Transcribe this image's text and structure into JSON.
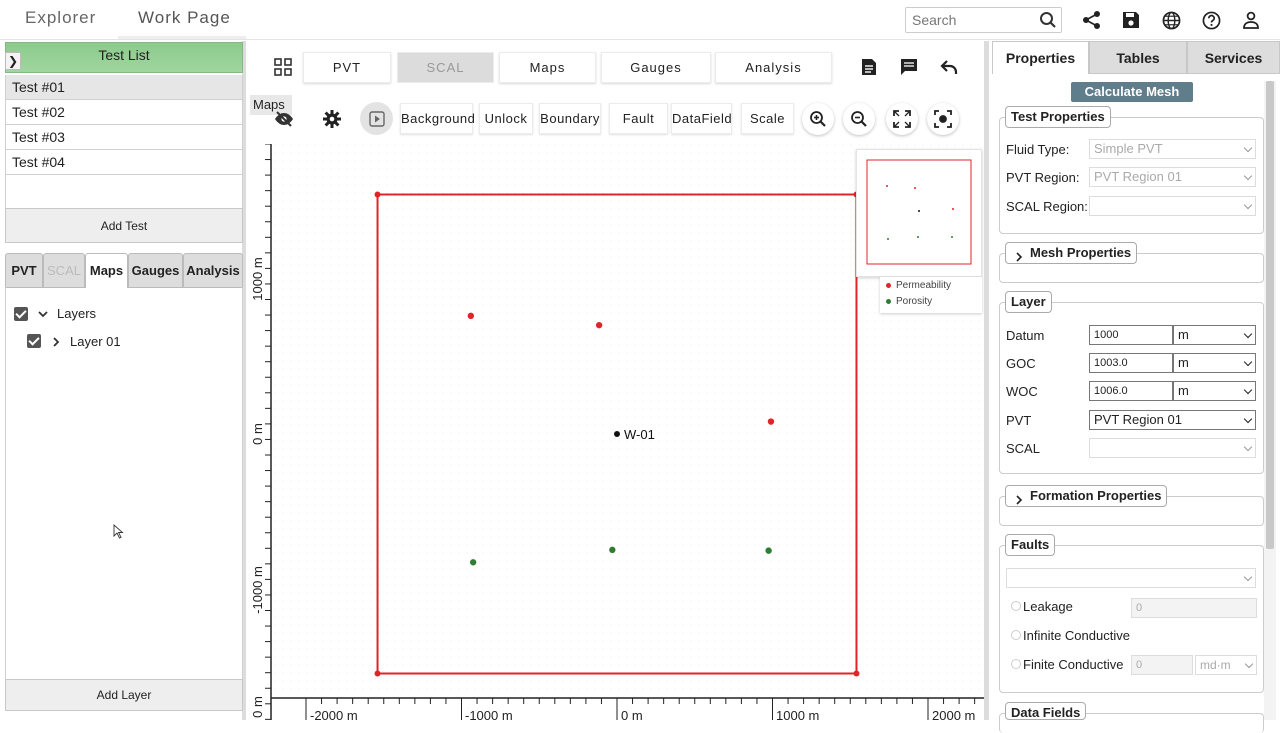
{
  "topbar": {
    "tabs": [
      "Explorer",
      "Work Page"
    ],
    "search_placeholder": "Search"
  },
  "left": {
    "test_list_header": "Test List",
    "tests": [
      "Test #01",
      "Test #02",
      "Test #03",
      "Test #04"
    ],
    "selected_test": "Test #01",
    "add_test_label": "Add Test",
    "subtabs": [
      "PVT",
      "SCAL",
      "Maps",
      "Gauges",
      "Analysis"
    ],
    "active_subtab": "Maps",
    "tree": {
      "root_label": "Layers",
      "child_label": "Layer 01"
    },
    "add_layer_label": "Add Layer"
  },
  "center": {
    "tabs": [
      "PVT",
      "SCAL",
      "Maps",
      "Gauges",
      "Analysis"
    ],
    "disabled_tab": "SCAL",
    "maps_label": "Maps",
    "buttons": [
      "Background",
      "Unlock",
      "Boundary",
      "Fault",
      "DataField",
      "Scale"
    ]
  },
  "chart_data": {
    "type": "scatter",
    "xlabel": "",
    "ylabel": "",
    "x_ticks": [
      "-2000 m",
      "-1000 m",
      "0 m",
      "1000 m",
      "2000 m"
    ],
    "y_ticks": [
      "1000 m",
      "0 m",
      "-1000 m",
      "0 m"
    ],
    "xlim": [
      -2000,
      2000
    ],
    "ylim": [
      -1550,
      1850
    ],
    "boundary": [
      [
        -1540,
        1540
      ],
      [
        1540,
        1540
      ],
      [
        1540,
        -1540
      ],
      [
        -1540,
        -1540
      ]
    ],
    "boundary_color": "#e0242a",
    "well": {
      "name": "W-01",
      "x": 0,
      "y": 0
    },
    "series": [
      {
        "name": "Permeability",
        "color": "#e0242a",
        "points": [
          [
            -940,
            760
          ],
          [
            -115,
            700
          ],
          [
            990,
            80
          ]
        ]
      },
      {
        "name": "Porosity",
        "color": "#2e7d32",
        "points": [
          [
            -925,
            -825
          ],
          [
            -30,
            -745
          ],
          [
            975,
            -750
          ]
        ]
      }
    ],
    "legend": [
      "Permeability",
      "Porosity"
    ]
  },
  "right": {
    "tabs": [
      "Properties",
      "Tables",
      "Services"
    ],
    "active_tab": "Properties",
    "calc_mesh_label": "Calculate Mesh",
    "test_properties": {
      "legend": "Test Properties",
      "fluid_type_label": "Fluid Type:",
      "fluid_type_value": "Simple PVT",
      "pvt_region_label": "PVT Region:",
      "pvt_region_value": "PVT Region 01",
      "scal_region_label": "SCAL Region:",
      "scal_region_value": ""
    },
    "mesh_properties_legend": "Mesh Properties",
    "layer": {
      "legend": "Layer",
      "datum_label": "Datum",
      "datum_value": "1000",
      "datum_unit": "m",
      "goc_label": "GOC",
      "goc_value": "1003.0",
      "goc_unit": "m",
      "woc_label": "WOC",
      "woc_value": "1006.0",
      "woc_unit": "m",
      "pvt_label": "PVT",
      "pvt_value": "PVT Region 01",
      "scal_label": "SCAL",
      "scal_value": ""
    },
    "formation_properties_legend": "Formation Properties",
    "faults": {
      "legend": "Faults",
      "leakage_label": "Leakage",
      "leakage_value": "0",
      "infinite_label": "Infinite Conductive",
      "finite_label": "Finite Conductive",
      "finite_value": "0",
      "finite_unit": "md·m"
    },
    "data_fields_legend": "Data Fields"
  }
}
